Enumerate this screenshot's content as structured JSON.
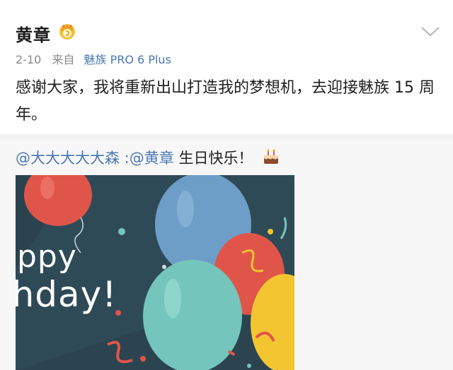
{
  "post": {
    "username": "黄章",
    "badge_icon": "crown-badge-icon",
    "date": "2-10",
    "source_prefix": "来自",
    "source": "魅族 PRO 6 Plus",
    "text": "感谢大家，我将重新出山打造我的梦想机，去迎接魅族 15 周年。"
  },
  "repost": {
    "author": "@大大大大大森",
    "separator": " :",
    "mention": "@黄章",
    "text": " 生日快乐！",
    "emoji": "cake-icon",
    "image_text_line1": "appy",
    "image_text_line2": "thday!"
  },
  "colors": {
    "link": "#4a78b3",
    "meta": "#8a8a8a",
    "image_bg": "#2f4a57"
  }
}
